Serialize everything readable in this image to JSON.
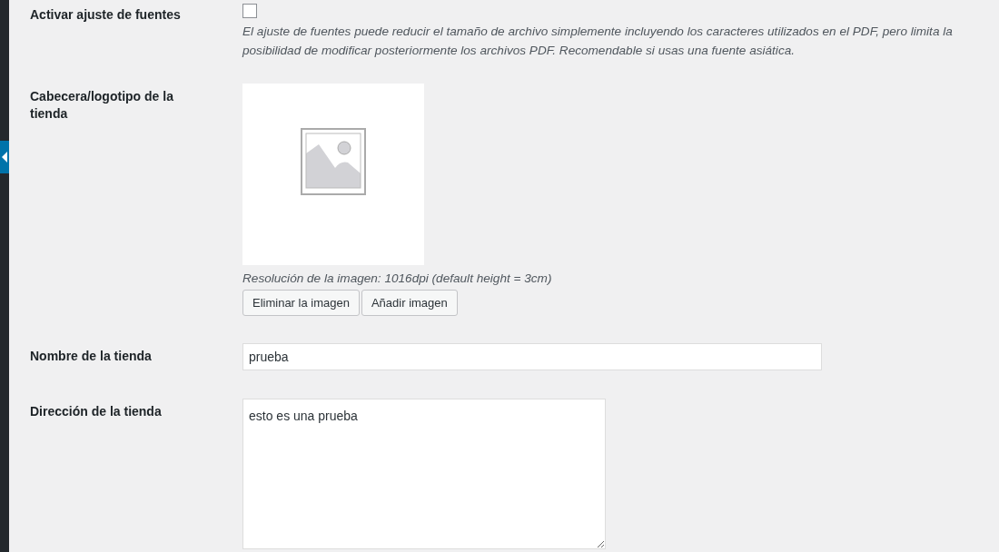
{
  "settings": [
    {
      "kind": "checkbox",
      "label": "Activar ajuste de fuentes",
      "checked": false,
      "description": "El ajuste de fuentes puede reducir el tamaño de archivo simplemente incluyendo los caracteres utilizados en el PDF, pero limita la posibilidad de modificar posteriormente los archivos PDF. Recomendable si usas una fuente asiática."
    },
    {
      "kind": "image",
      "label": "Cabecera/logotipo de la tienda",
      "description": "Resolución de la imagen: 1016dpi (default height = 3cm)",
      "buttons": [
        "Eliminar la imagen",
        "Añadir imagen"
      ]
    },
    {
      "kind": "text",
      "label": "Nombre de la tienda",
      "value": "prueba"
    },
    {
      "kind": "textarea",
      "label": "Dirección de la tienda",
      "value": "esto es una prueba"
    }
  ]
}
